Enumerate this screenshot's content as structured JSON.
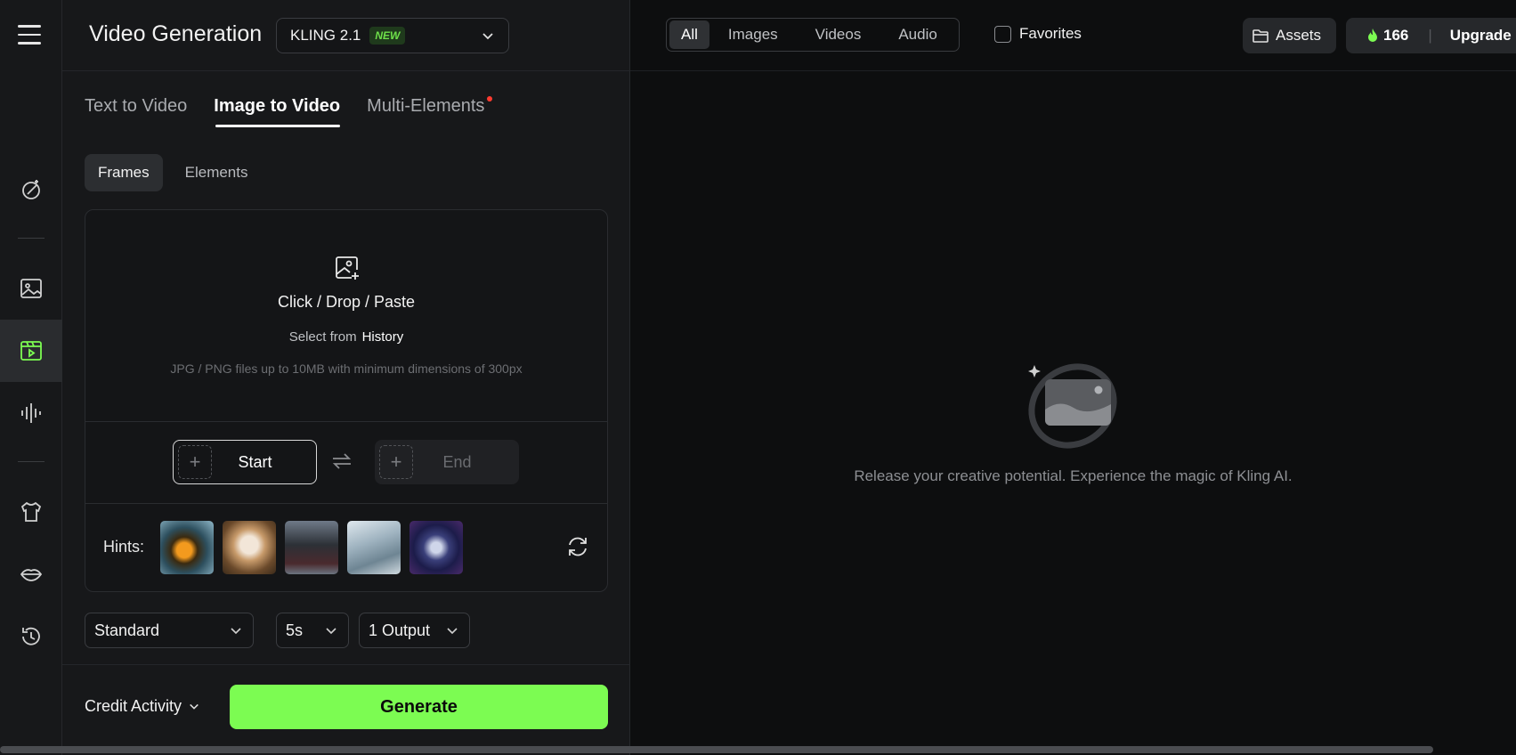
{
  "header": {
    "title": "Video Generation",
    "model": {
      "name": "KLING 2.1",
      "badge": "NEW"
    }
  },
  "mode_tabs": [
    {
      "label": "Text to Video",
      "active": false
    },
    {
      "label": "Image to Video",
      "active": true
    },
    {
      "label": "Multi-Elements",
      "active": false,
      "has_dot": true
    }
  ],
  "sub_tabs": [
    {
      "label": "Frames",
      "active": true
    },
    {
      "label": "Elements",
      "active": false
    }
  ],
  "upload": {
    "title": "Click / Drop / Paste",
    "select_prefix": "Select from",
    "select_link": "History",
    "note": "JPG / PNG files up to 10MB with minimum dimensions of 300px"
  },
  "frames": {
    "start": "Start",
    "end": "End"
  },
  "hints": {
    "label": "Hints:",
    "items": [
      "pumpkin-house",
      "puppy-with-flower",
      "dark-towers",
      "misty-mountain",
      "astronaut-space"
    ]
  },
  "settings": {
    "quality": "Standard",
    "duration": "5s",
    "outputs": "1 Output"
  },
  "footer": {
    "credit_activity": "Credit Activity",
    "generate": "Generate"
  },
  "topbar": {
    "filters": [
      {
        "label": "All",
        "active": true
      },
      {
        "label": "Images",
        "active": false
      },
      {
        "label": "Videos",
        "active": false
      },
      {
        "label": "Audio",
        "active": false
      }
    ],
    "favorites": "Favorites",
    "assets": "Assets",
    "credits": "166",
    "upgrade": "Upgrade"
  },
  "empty_state": {
    "message": "Release your creative potential. Experience the magic of Kling AI."
  },
  "colors": {
    "accent": "#7cfc52",
    "background": "#0d0e0f",
    "panel": "#17181a"
  }
}
